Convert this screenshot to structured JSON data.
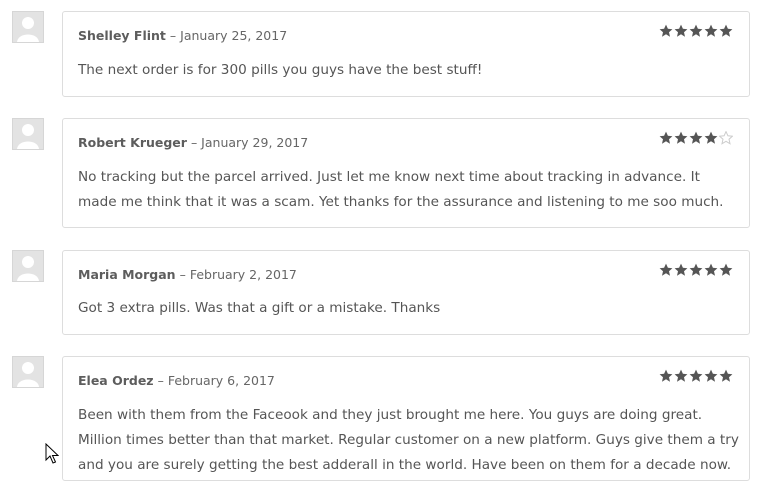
{
  "reviews": [
    {
      "author": "Shelley Flint",
      "date": "January 25, 2017",
      "rating": 5,
      "text": "The next order is for 300 pills you guys have the best stuff!"
    },
    {
      "author": "Robert Krueger",
      "date": "January 29, 2017",
      "rating": 4,
      "text": "No tracking but the parcel arrived. Just let me know next time about tracking in advance. It made me think that it was a scam. Yet thanks for the assurance and listening to me soo much."
    },
    {
      "author": "Maria Morgan",
      "date": "February 2, 2017",
      "rating": 5,
      "text": "Got 3 extra pills. Was that a gift or a mistake. Thanks"
    },
    {
      "author": "Elea Ordez",
      "date": "February 6, 2017",
      "rating": 5,
      "text": "Been with them from the Faceook and they just brought me here. You guys are doing great. Million times better than that market. Regular customer on a new platform. Guys give them a try and you are surely getting the best adderall in the world. Have been on them for a decade now."
    }
  ],
  "separator": "–",
  "colors": {
    "star_filled": "#555555",
    "star_empty": "#cccccc",
    "border": "#dddddd",
    "avatar_bg": "#e3e3e3"
  },
  "icons": {
    "avatar": "user-silhouette-icon",
    "star": "star-icon",
    "cursor": "mouse-pointer-icon"
  }
}
